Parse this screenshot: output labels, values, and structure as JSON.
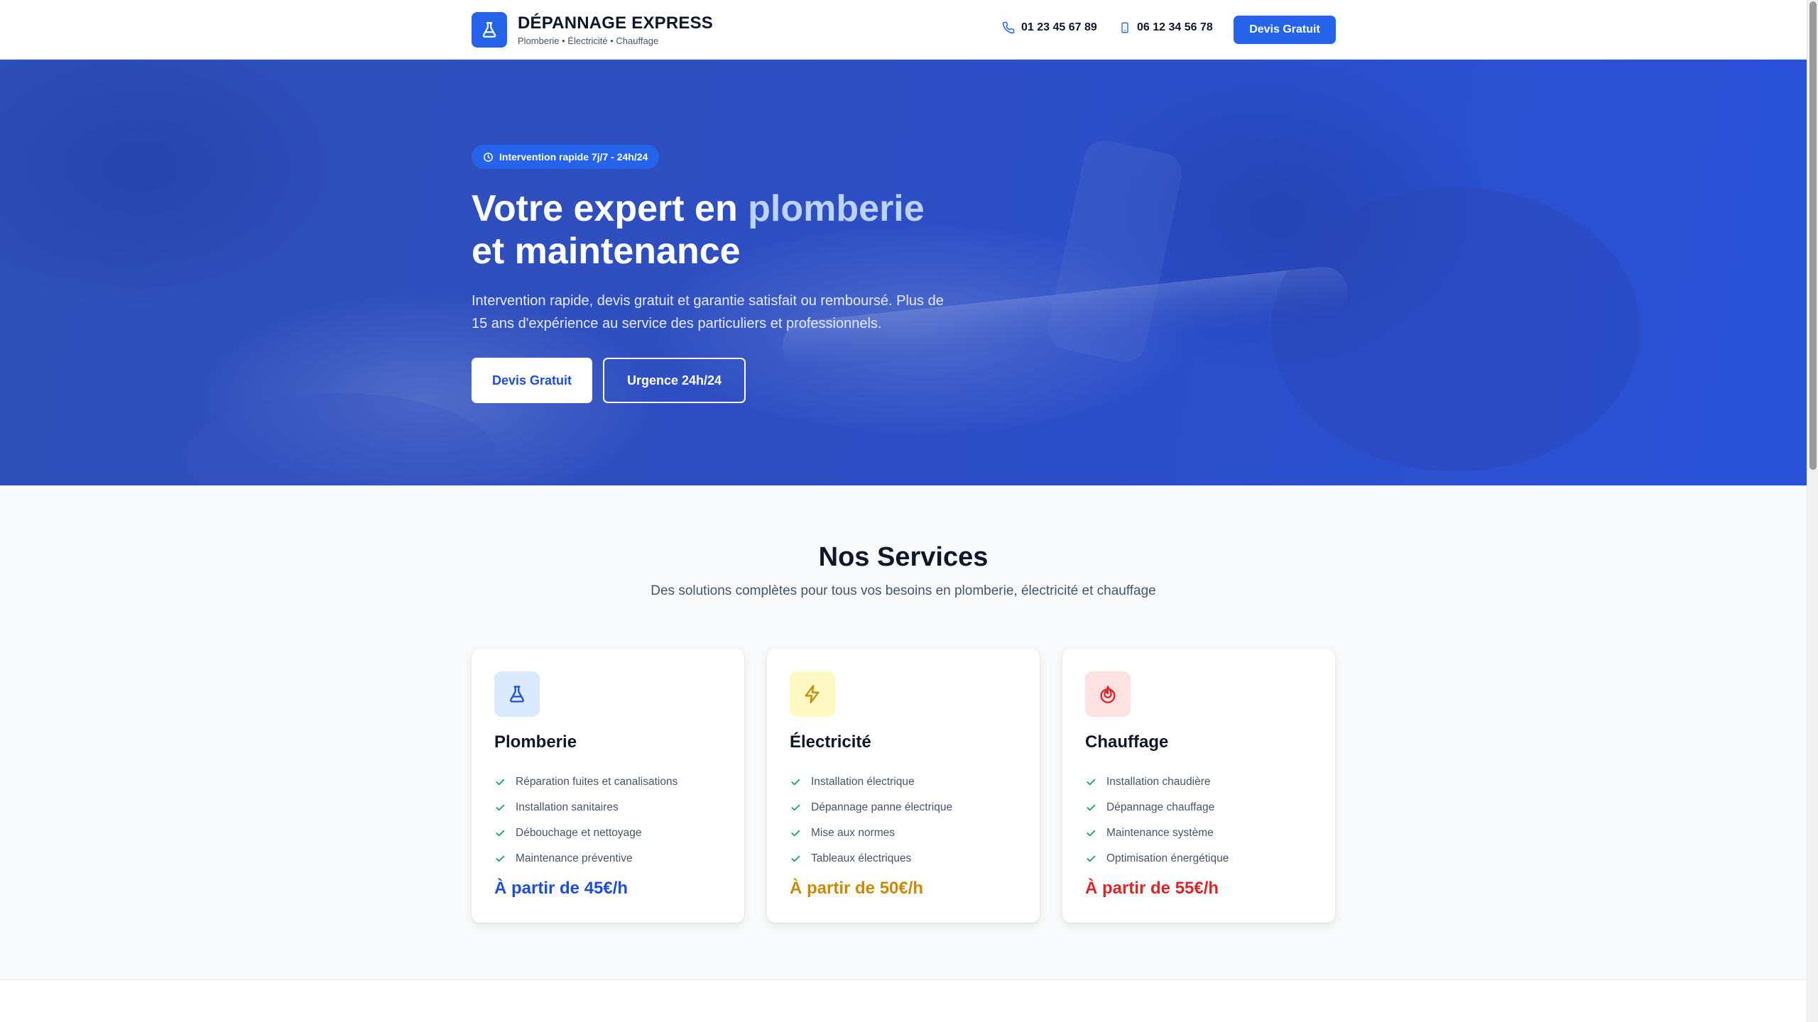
{
  "header": {
    "brand_title": "DÉPANNAGE EXPRESS",
    "brand_subtitle": "Plomberie • Électricité • Chauffage",
    "logo_icon": "flask-icon",
    "phone_landline": "01 23 45 67 89",
    "phone_mobile": "06 12 34 56 78",
    "cta_label": "Devis Gratuit"
  },
  "hero": {
    "badge": "Intervention rapide 7j/7 - 24h/24",
    "title_part1": "Votre expert en ",
    "title_accent": "plomberie",
    "title_part2": "et maintenance",
    "description": "Intervention rapide, devis gratuit et garantie satisfait ou remboursé. Plus de 15 ans d'expérience au service des particuliers et professionnels.",
    "primary_button": "Devis Gratuit",
    "secondary_button": "Urgence 24h/24"
  },
  "services": {
    "title": "Nos Services",
    "subtitle": "Des solutions complètes pour tous vos besoins en plomberie, électricité et chauffage",
    "cards": [
      {
        "icon": "flask-icon",
        "title": "Plomberie",
        "items": [
          "Réparation fuites et canalisations",
          "Installation sanitaires",
          "Débouchage et nettoyage",
          "Maintenance préventive"
        ],
        "price": "À partir de 45€/h",
        "accent": "#1d4ed8",
        "icon_bg": "#dbeafe"
      },
      {
        "icon": "lightning-icon",
        "title": "Électricité",
        "items": [
          "Installation électrique",
          "Dépannage panne électrique",
          "Mise aux normes",
          "Tableaux électriques"
        ],
        "price": "À partir de 50€/h",
        "accent": "#ca8a04",
        "icon_bg": "#fef9c3"
      },
      {
        "icon": "flame-icon",
        "title": "Chauffage",
        "items": [
          "Installation chaudière",
          "Dépannage chauffage",
          "Maintenance système",
          "Optimisation énergétique"
        ],
        "price": "À partir de 55€/h",
        "accent": "#dc2626",
        "icon_bg": "#fee2e2"
      }
    ]
  },
  "colors": {
    "primary": "#2563eb",
    "check": "#16a34a"
  }
}
